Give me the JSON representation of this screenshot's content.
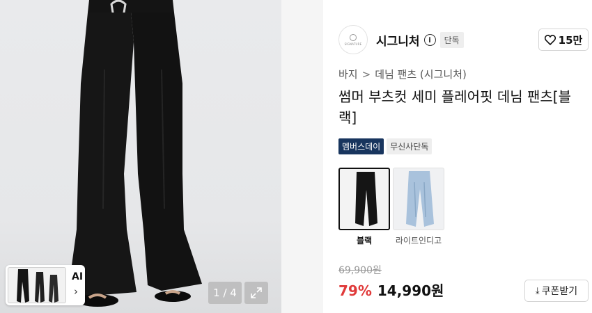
{
  "photo": {
    "pager_text": "1 / 4",
    "ai_label": "AI",
    "chevron": "›",
    "expand_icon": "expand-icon"
  },
  "brand": {
    "logo_text": "SIGNATURE",
    "name": "시그니처",
    "info_icon": "i",
    "tag": "단독",
    "likes": "15만"
  },
  "breadcrumb": {
    "category": "바지",
    "separator": ">",
    "subcategory": "데님 팬츠 (시그니처)"
  },
  "product": {
    "title": "썸머 부츠컷 세미 플레어핏 데님 팬츠[블랙]"
  },
  "badges": {
    "member": "멤버스데이",
    "exclusive": "무신사단독"
  },
  "options": [
    {
      "label": "블랙",
      "selected": true,
      "color": "#151515"
    },
    {
      "label": "라이트인디고",
      "selected": false,
      "color": "#a9c2dc"
    }
  ],
  "pricing": {
    "original": "69,900원",
    "discount": "79%",
    "price": "14,990원",
    "coupon_button": "쿠폰받기",
    "coupon_icon": "⤓"
  },
  "colors": {
    "discount": "#e03a3a",
    "member_badge": "#18355e"
  }
}
